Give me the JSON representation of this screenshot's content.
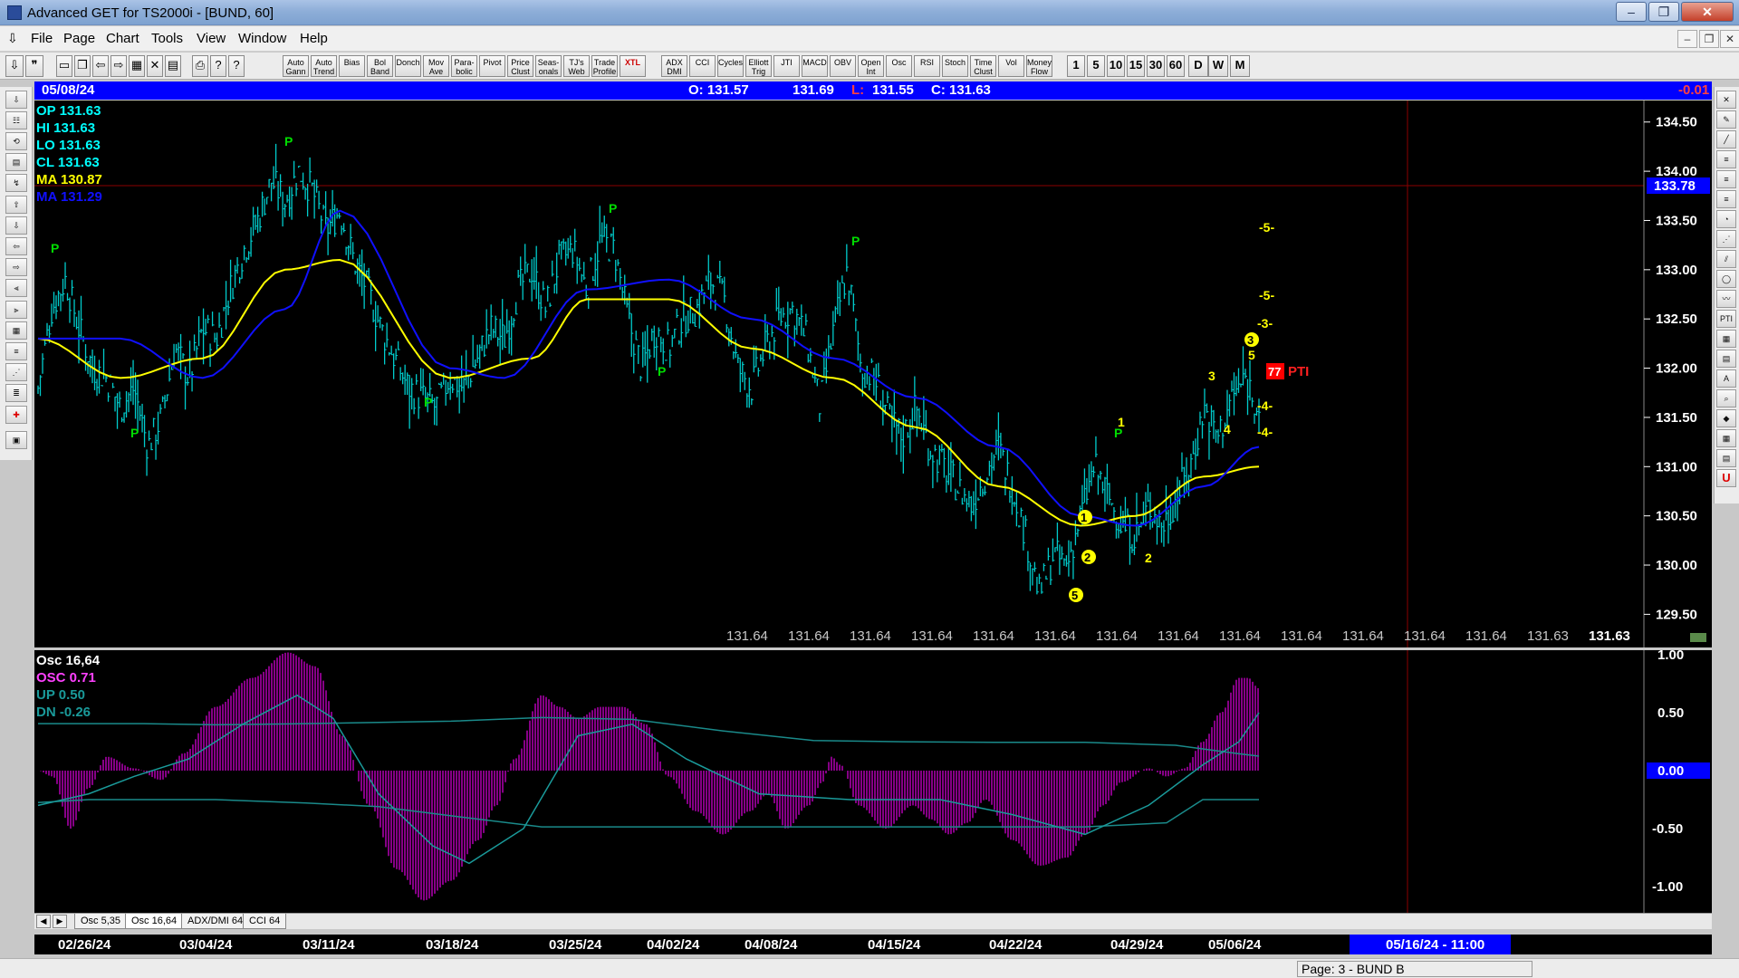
{
  "window": {
    "title": "Advanced GET for TS2000i - [BUND, 60]"
  },
  "menu": [
    "File",
    "Page",
    "Chart",
    "Tools",
    "View",
    "Window",
    "Help"
  ],
  "toolbar": {
    "study_buttons": [
      "Auto Gann",
      "Auto Trend",
      "Bias",
      "Bol Band",
      "Donch",
      "Mov Ave",
      "Para-bolic",
      "Pivot",
      "Price Clust",
      "Seas-onals",
      "TJ's Web",
      "Trade Profile",
      "XTL",
      "ADX DMI",
      "CCI",
      "Cycles",
      "Elliott Trig",
      "JTI",
      "MACD",
      "OBV",
      "Open Int",
      "Osc",
      "RSI",
      "Stoch",
      "Time Clust",
      "Vol",
      "Money Flow"
    ],
    "timeframes": [
      "1",
      "5",
      "10",
      "15",
      "30",
      "60",
      "D",
      "W",
      "M"
    ]
  },
  "infobar": {
    "date": "05/08/24",
    "open": "O: 131.57",
    "high": "131.69",
    "low_label": "L:",
    "low": "131.55",
    "close": "C: 131.63",
    "change": "-0.01"
  },
  "legend": {
    "op": "OP  131.63",
    "hi": "HI   131.63",
    "lo": "LO  131.63",
    "cl": "CL  131.63",
    "ma1": "MA  130.87",
    "ma2": "MA  131.29"
  },
  "price_axis": {
    "ticks": [
      "134.50",
      "134.00",
      "133.50",
      "133.00",
      "132.50",
      "132.00",
      "131.50",
      "131.00",
      "130.50",
      "130.00",
      "129.50"
    ],
    "highlight": "133.78"
  },
  "bottom_values": [
    "131.64",
    "131.64",
    "131.64",
    "131.64",
    "131.64",
    "131.64",
    "131.64",
    "131.64",
    "131.64",
    "131.64",
    "131.64",
    "131.64",
    "131.64",
    "131.63",
    "131.63"
  ],
  "annotations": {
    "pivot": "P",
    "pti": "77",
    "pti_label": "PTI",
    "elliott": [
      "5",
      "2",
      "1",
      "3",
      "5",
      "1",
      "2",
      "3",
      "4"
    ],
    "targets": [
      "-5-",
      "-5-",
      "-3-",
      "-4-",
      "-4-"
    ]
  },
  "oscillator": {
    "title": "Osc 16,64",
    "osc": "OSC 0.71",
    "up": "UP   0.50",
    "dn": "DN   -0.26",
    "axis": [
      "1.00",
      "0.50",
      "0.00",
      "-0.50",
      "-1.00"
    ]
  },
  "tabs": [
    "Osc 5,35",
    "Osc 16,64",
    "ADX/DMI 64",
    "CCI 64"
  ],
  "dates": [
    "02/26/24",
    "03/04/24",
    "03/11/24",
    "03/18/24",
    "03/25/24",
    "04/02/24",
    "04/08/24",
    "04/15/24",
    "04/22/24",
    "04/29/24",
    "05/06/24"
  ],
  "cursor_date": "05/16/24 - 11:00",
  "status": "Page: 3 - BUND B",
  "colors": {
    "ma_fast": "#ffff00",
    "ma_slow": "#1010ff",
    "bars": "#00cccc",
    "osc": "#c000c0",
    "pivot": "#00dd00",
    "target": "#ffff00"
  },
  "chart_data": {
    "type": "bar",
    "symbol": "BUND",
    "interval": "60",
    "ylim": [
      129.2,
      134.7
    ],
    "close_path": [
      [
        0,
        131.8
      ],
      [
        1,
        132.6
      ],
      [
        2,
        132.9
      ],
      [
        3,
        132.4
      ],
      [
        4,
        132.0
      ],
      [
        5,
        131.9
      ],
      [
        6,
        131.6
      ],
      [
        7,
        131.8
      ],
      [
        8,
        131.2
      ],
      [
        9,
        131.5
      ],
      [
        10,
        132.2
      ],
      [
        11,
        131.9
      ],
      [
        12,
        132.4
      ],
      [
        13,
        132.3
      ],
      [
        14,
        132.8
      ],
      [
        15,
        133.2
      ],
      [
        16,
        133.5
      ],
      [
        17,
        133.9
      ],
      [
        18,
        133.7
      ],
      [
        19,
        134.0
      ],
      [
        20,
        133.8
      ],
      [
        21,
        133.4
      ],
      [
        22,
        133.6
      ],
      [
        23,
        133.1
      ],
      [
        24,
        132.8
      ],
      [
        25,
        132.4
      ],
      [
        26,
        132.1
      ],
      [
        27,
        131.8
      ],
      [
        28,
        131.7
      ],
      [
        29,
        131.6
      ],
      [
        30,
        131.9
      ],
      [
        31,
        131.8
      ],
      [
        32,
        132.1
      ],
      [
        33,
        132.4
      ],
      [
        34,
        132.3
      ],
      [
        35,
        132.8
      ],
      [
        36,
        133.0
      ],
      [
        37,
        132.6
      ],
      [
        38,
        133.1
      ],
      [
        39,
        133.2
      ],
      [
        40,
        132.8
      ],
      [
        41,
        133.3
      ],
      [
        42,
        133.2
      ],
      [
        43,
        132.5
      ],
      [
        44,
        132.0
      ],
      [
        45,
        132.4
      ],
      [
        46,
        132.2
      ],
      [
        47,
        132.5
      ],
      [
        48,
        132.6
      ],
      [
        49,
        132.9
      ],
      [
        50,
        132.7
      ],
      [
        51,
        132.0
      ],
      [
        52,
        131.8
      ],
      [
        53,
        132.2
      ],
      [
        54,
        132.5
      ],
      [
        55,
        132.6
      ],
      [
        56,
        132.3
      ],
      [
        57,
        131.6
      ],
      [
        58,
        132.4
      ],
      [
        59,
        133.0
      ],
      [
        60,
        132.0
      ],
      [
        61,
        131.9
      ],
      [
        62,
        131.5
      ],
      [
        63,
        131.3
      ],
      [
        64,
        131.6
      ],
      [
        65,
        131.2
      ],
      [
        66,
        131.0
      ],
      [
        67,
        130.8
      ],
      [
        68,
        130.6
      ],
      [
        69,
        130.9
      ],
      [
        70,
        131.2
      ],
      [
        71,
        130.8
      ],
      [
        72,
        130.3
      ],
      [
        73,
        129.7
      ],
      [
        74,
        130.1
      ],
      [
        75,
        130.0
      ],
      [
        76,
        130.5
      ],
      [
        77,
        131.0
      ],
      [
        78,
        130.7
      ],
      [
        79,
        130.4
      ],
      [
        80,
        130.3
      ],
      [
        81,
        130.6
      ],
      [
        82,
        130.4
      ],
      [
        83,
        130.7
      ],
      [
        84,
        131.0
      ],
      [
        85,
        131.6
      ],
      [
        86,
        131.3
      ],
      [
        87,
        131.7
      ],
      [
        88,
        131.9
      ],
      [
        89,
        131.6
      ]
    ],
    "ma_fast_path": [
      [
        0,
        132.3
      ],
      [
        6,
        131.9
      ],
      [
        12,
        132.1
      ],
      [
        18,
        133.0
      ],
      [
        22,
        133.1
      ],
      [
        30,
        131.9
      ],
      [
        36,
        132.1
      ],
      [
        40,
        132.7
      ],
      [
        46,
        132.7
      ],
      [
        52,
        132.2
      ],
      [
        58,
        131.9
      ],
      [
        64,
        131.4
      ],
      [
        70,
        130.8
      ],
      [
        76,
        130.4
      ],
      [
        80,
        130.5
      ],
      [
        85,
        130.9
      ],
      [
        89,
        131.0
      ]
    ],
    "ma_slow_path": [
      [
        0,
        132.3
      ],
      [
        6,
        132.3
      ],
      [
        12,
        131.9
      ],
      [
        18,
        132.6
      ],
      [
        22,
        133.6
      ],
      [
        30,
        132.0
      ],
      [
        34,
        131.9
      ],
      [
        40,
        132.8
      ],
      [
        46,
        132.9
      ],
      [
        52,
        132.5
      ],
      [
        58,
        132.1
      ],
      [
        64,
        131.7
      ],
      [
        70,
        131.2
      ],
      [
        76,
        130.5
      ],
      [
        80,
        130.4
      ],
      [
        85,
        130.8
      ],
      [
        89,
        131.2
      ]
    ]
  }
}
